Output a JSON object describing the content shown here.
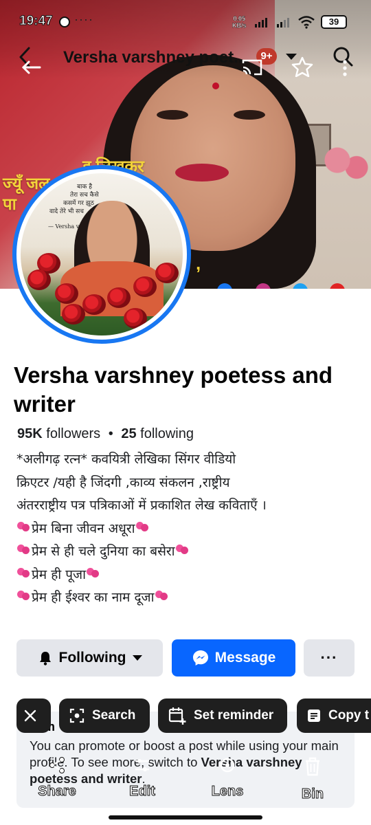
{
  "status_bar": {
    "time": "19:47",
    "net_speed_value": "0.05",
    "net_speed_unit": "KB/s",
    "battery": "39"
  },
  "navbar": {
    "title": "Versha varshney poet...",
    "notification_badge": "9+"
  },
  "cover": {
    "text_line1": "ज्यूँ जल",
    "text_line2": "पा",
    "text_line3": "ह लिखकर",
    "text_line4": ","
  },
  "avatar": {
    "poem_lines": [
      "बाक है",
      "तेरा सच कैसे",
      "कसमें गर झूठ",
      "वादे तेरे भी सच",
      "— Versha varshney"
    ]
  },
  "profile": {
    "name": "Versha varshney poetess and writer",
    "followers_count": "95K",
    "followers_label": "followers",
    "separator": "•",
    "following_count": "25",
    "following_label": "following",
    "bio_lines": [
      "*अलीगढ़ रत्न* कवयित्री लेखिका सिंगर वीडियो",
      "क्रिएटर /यही है जिंदगी ,काव्य संकलन ,राष्ट्रीय",
      "अंतरराष्ट्रीय पत्र पत्रिकाओं में प्रकाशित लेख कविताएँ ।",
      "प्रेम बिना जीवन अधूरा",
      "प्रेम से ही चले दुनिया का बसेरा",
      "प्रेम ही पूजा",
      "प्रेम ही ईश्वर का नाम दूजा"
    ]
  },
  "actions": {
    "following_label": "Following",
    "message_label": "Message",
    "more_label": "···"
  },
  "promo": {
    "heading_partial": "m",
    "text_before": "You can promote or boost a post while using your main profile. To see more, switch to ",
    "text_bold": "Versha varshney poetess and writer",
    "text_after": "."
  },
  "lens_chips": {
    "search_label": "Search",
    "reminder_label": "Set reminder",
    "copy_label": "Copy t"
  },
  "bottom_bar": {
    "share_label": "Share",
    "edit_label": "Edit",
    "lens_label": "Lens",
    "bin_label": "Bin"
  },
  "colors": {
    "accent_blue": "#0866ff",
    "avatar_ring": "#1877f2",
    "badge_red": "#c0392b",
    "secondary_button": "#e4e6eb"
  }
}
